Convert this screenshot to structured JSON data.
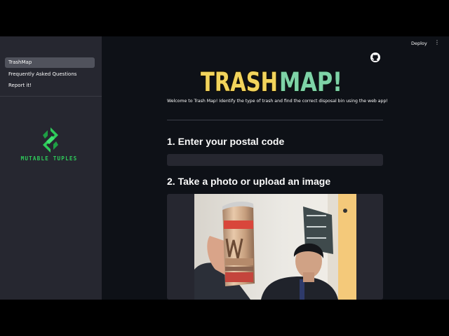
{
  "header": {
    "deploy_label": "Deploy",
    "menu_glyph": "⋮",
    "github_icon": "github-icon"
  },
  "sidebar": {
    "items": [
      {
        "label": "TrashMap",
        "active": true
      },
      {
        "label": "Frequently Asked Questions",
        "active": false
      },
      {
        "label": "Report it!",
        "active": false
      }
    ],
    "brand": "MUTABLE TUPLES",
    "brand_color": "#2ecb5a"
  },
  "main": {
    "title_part1": "TRASH",
    "title_part2": "MAP!",
    "title_color1": "#f2d45c",
    "title_color2": "#7ed3a7",
    "welcome": "Welcome to Trash Map! Identify the type of trash and find the correct disposal bin using the web app!",
    "step1_heading": "1. Enter your postal code",
    "postal_value": "",
    "step2_heading": "2. Take a photo or upload an image"
  }
}
